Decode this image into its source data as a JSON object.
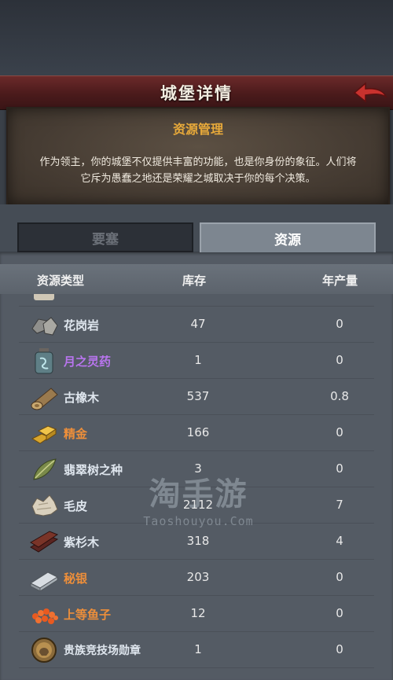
{
  "colors": {
    "name_default": "#dfe6ee",
    "name_purple": "#b875ee",
    "name_orange": "#ee8f3a",
    "parchment_title": "#e7a93a"
  },
  "header": {
    "title": "城堡详情",
    "back_icon": "red-back-arrow-icon"
  },
  "panel": {
    "title": "资源管理",
    "body_line1": "作为领主，你的城堡不仅提供丰富的功能，也是你身份的象征。人们将",
    "body_line2": "它斥为愚蠢之地还是荣耀之城取决于你的每个决策。"
  },
  "tabs": [
    {
      "label": "要塞",
      "active": false
    },
    {
      "label": "资源",
      "active": true
    }
  ],
  "table": {
    "headers": {
      "type": "资源类型",
      "stock": "库存",
      "rate": "年产量"
    },
    "rows": [
      {
        "icon": "granite-icon",
        "name": "花岗岩",
        "stock": "47",
        "rate": "0",
        "color": "default"
      },
      {
        "icon": "moon-elixir-icon",
        "name": "月之灵药",
        "stock": "1",
        "rate": "0",
        "color": "purple"
      },
      {
        "icon": "ancient-oak-log-icon",
        "name": "古橡木",
        "stock": "537",
        "rate": "0.8",
        "color": "default"
      },
      {
        "icon": "fine-gold-icon",
        "name": "精金",
        "stock": "166",
        "rate": "0",
        "color": "orange"
      },
      {
        "icon": "emerald-seed-icon",
        "name": "翡翠树之种",
        "stock": "3",
        "rate": "0",
        "color": "default"
      },
      {
        "icon": "fur-pelt-icon",
        "name": "毛皮",
        "stock": "2112",
        "rate": "7",
        "color": "default"
      },
      {
        "icon": "yew-wood-icon",
        "name": "紫杉木",
        "stock": "318",
        "rate": "4",
        "color": "default"
      },
      {
        "icon": "mithril-ingot-icon",
        "name": "秘银",
        "stock": "203",
        "rate": "0",
        "color": "orange"
      },
      {
        "icon": "fine-caviar-icon",
        "name": "上等鱼子",
        "stock": "12",
        "rate": "0",
        "color": "orange"
      },
      {
        "icon": "noble-arena-medal-icon",
        "name": "贵族竞技场勋章",
        "stock": "1",
        "rate": "0",
        "color": "default"
      }
    ]
  },
  "watermark": {
    "main": "淘手游",
    "sub": "Taoshouyou.Com"
  }
}
